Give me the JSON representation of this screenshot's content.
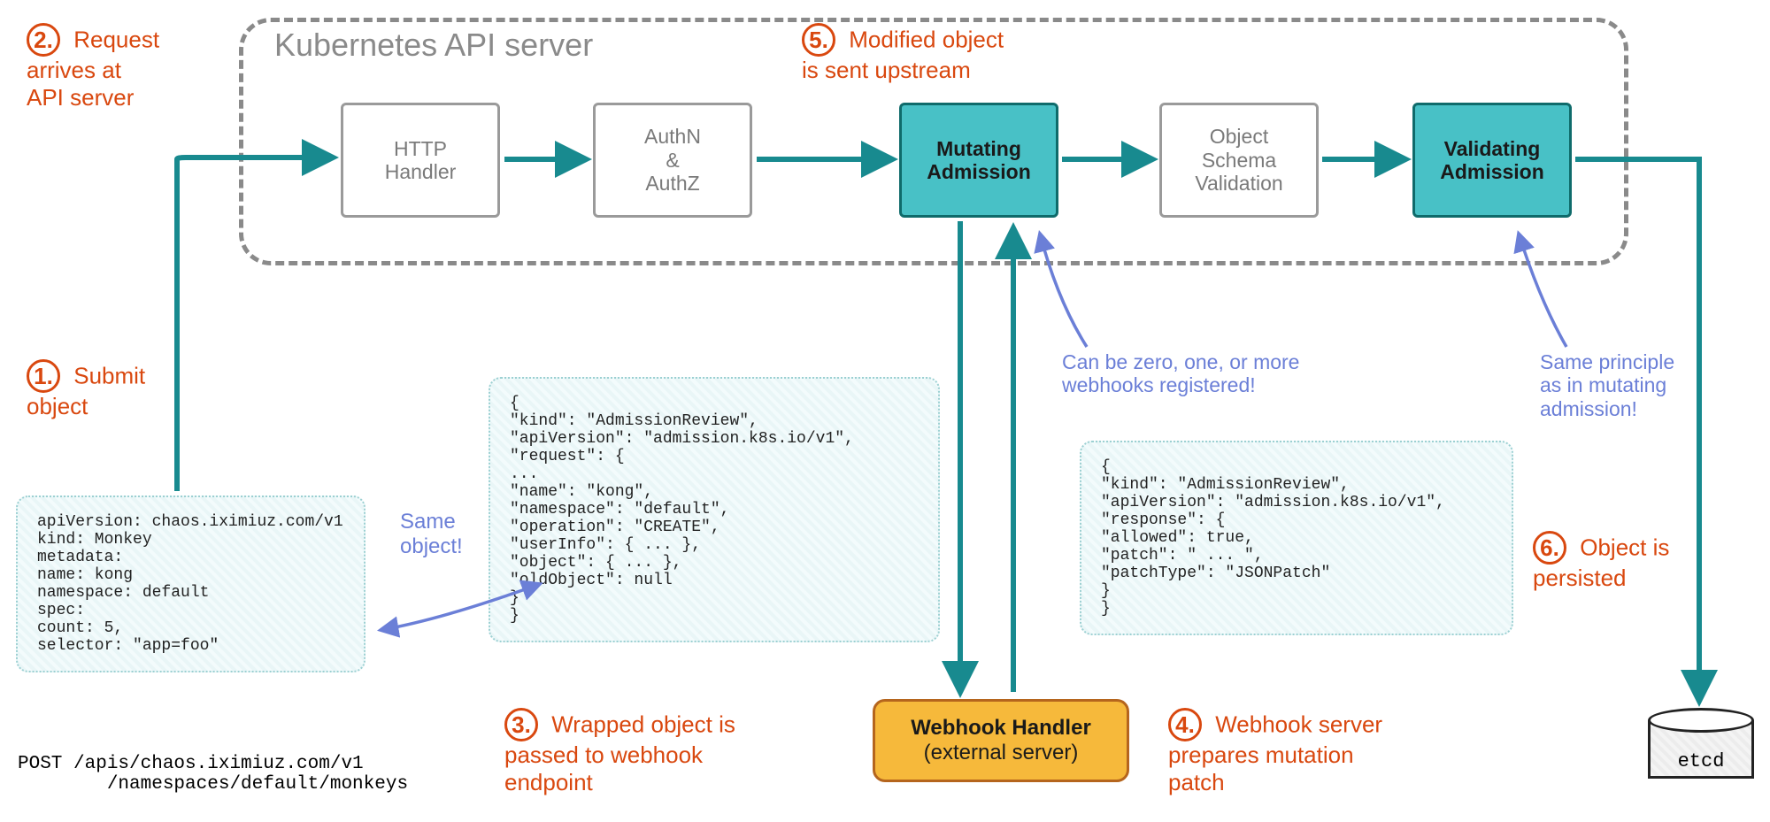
{
  "api_server": {
    "title": "Kubernetes API server"
  },
  "stages": {
    "http": "HTTP\nHandler",
    "auth": "AuthN\n&\nAuthZ",
    "mut": "Mutating\nAdmission",
    "sch": "Object\nSchema\nValidation",
    "val": "Validating\nAdmission"
  },
  "steps": {
    "s1": {
      "n": "1.",
      "t": "Submit\nobject"
    },
    "s2": {
      "n": "2.",
      "t": "Request\narrives at\nAPI server"
    },
    "s3": {
      "n": "3.",
      "t": "Wrapped object is\npassed to webhook\nendpoint"
    },
    "s4": {
      "n": "4.",
      "t": "Webhook server\nprepares mutation\npatch"
    },
    "s5": {
      "n": "5.",
      "t": "Modified object\nis sent upstream"
    },
    "s6": {
      "n": "6.",
      "t": "Object is\npersisted"
    }
  },
  "notes": {
    "same_object": "Same\nobject!",
    "webhooks_note": "Can be zero, one, or more\nwebhooks registered!",
    "validating_note": "Same principle\nas in mutating\nadmission!"
  },
  "webhook": {
    "line1": "Webhook Handler",
    "line2": "(external server)"
  },
  "etcd": {
    "label": "etcd"
  },
  "post": "POST /apis/chaos.iximiuz.com/v1\n        /namespaces/default/monkeys",
  "code": {
    "yaml": "apiVersion: chaos.iximiuz.com/v1\nkind: Monkey\nmetadata:\n    name: kong\n    namespace: default\nspec:\n    count: 5,\n    selector: \"app=foo\"",
    "request": "{\n    \"kind\": \"AdmissionReview\",\n    \"apiVersion\": \"admission.k8s.io/v1\",\n    \"request\": {\n        ...\n        \"name\": \"kong\",\n        \"namespace\": \"default\",\n        \"operation\": \"CREATE\",\n        \"userInfo\": { ... },\n        \"object\": { ... },\n        \"oldObject\": null\n    }\n}",
    "response": "{\n    \"kind\": \"AdmissionReview\",\n    \"apiVersion\": \"admission.k8s.io/v1\",\n    \"response\": {\n        \"allowed\": true,\n        \"patch\": \" ... \",\n        \"patchType\": \"JSONPatch\"\n    }\n}"
  },
  "colors": {
    "teal": "#188a8f",
    "orange": "#d9480f",
    "hand_blue": "#6b7fd7",
    "gray": "#8a8a8a"
  }
}
